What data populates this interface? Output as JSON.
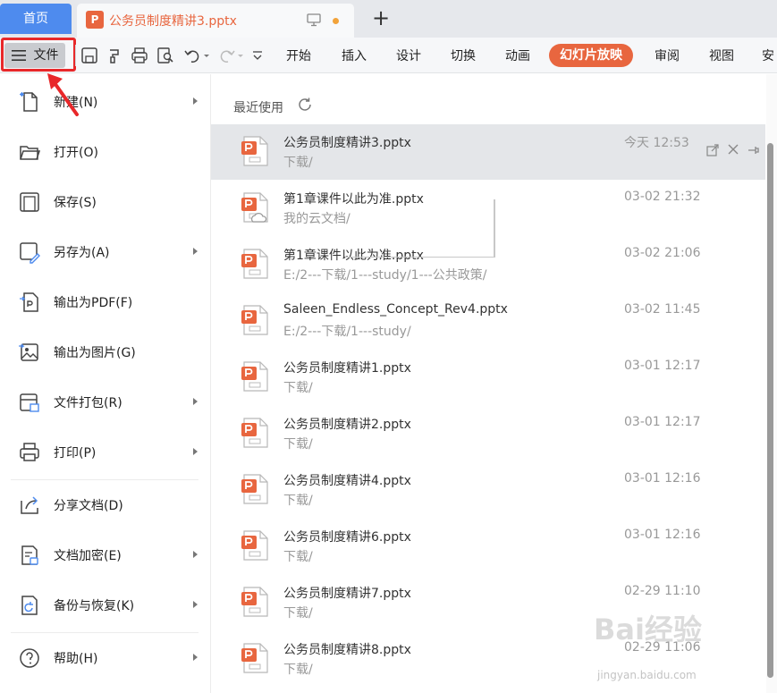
{
  "tabs": {
    "home": "首页",
    "document": "公务员制度精讲3.pptx",
    "add": "+"
  },
  "toolbar": {
    "file_label": "文件",
    "ribbon_tabs": [
      "开始",
      "插入",
      "设计",
      "切换",
      "动画",
      "幻灯片放映",
      "审阅",
      "视图",
      "安"
    ],
    "active_tab": "幻灯片放映",
    "accent_color": "#e8663f",
    "icons": [
      "save-icon",
      "format-painter-icon",
      "print-icon",
      "print-preview-icon",
      "undo-icon",
      "redo-icon",
      "more-icon"
    ]
  },
  "file_menu": {
    "items": [
      {
        "label": "新建(N)",
        "icon": "new-file-icon",
        "submenu": true
      },
      {
        "label": "打开(O)",
        "icon": "folder-open-icon",
        "submenu": false
      },
      {
        "label": "保存(S)",
        "icon": "save-icon",
        "submenu": false
      },
      {
        "label": "另存为(A)",
        "icon": "save-as-icon",
        "submenu": true
      },
      {
        "label": "输出为PDF(F)",
        "icon": "export-pdf-icon",
        "submenu": false
      },
      {
        "label": "输出为图片(G)",
        "icon": "export-image-icon",
        "submenu": false
      },
      {
        "label": "文件打包(R)",
        "icon": "package-icon",
        "submenu": true
      },
      {
        "label": "打印(P)",
        "icon": "print-icon",
        "submenu": true
      },
      {
        "label": "分享文档(D)",
        "icon": "share-icon",
        "submenu": false
      },
      {
        "label": "文档加密(E)",
        "icon": "encrypt-icon",
        "submenu": true
      },
      {
        "label": "备份与恢复(K)",
        "icon": "backup-icon",
        "submenu": true
      },
      {
        "label": "帮助(H)",
        "icon": "help-icon",
        "submenu": true
      }
    ]
  },
  "recent": {
    "header": "最近使用",
    "files": [
      {
        "name": "公务员制度精讲3.pptx",
        "path": "下载/",
        "time": "今天 12:53",
        "selected": true
      },
      {
        "name": "第1章课件以此为准.pptx",
        "path": "我的云文档/",
        "time": "03-02 21:32",
        "cloud": true
      },
      {
        "name": "第1章课件以此为准.pptx",
        "path": "E:/2---下载/1---study/1---公共政策/",
        "time": "03-02 21:06"
      },
      {
        "name": "Saleen_Endless_Concept_Rev4.pptx",
        "path": "E:/2---下载/1---study/",
        "time": "03-02 11:45"
      },
      {
        "name": "公务员制度精讲1.pptx",
        "path": "下载/",
        "time": "03-01 12:17"
      },
      {
        "name": "公务员制度精讲2.pptx",
        "path": "下载/",
        "time": "03-01 12:17"
      },
      {
        "name": "公务员制度精讲4.pptx",
        "path": "下载/",
        "time": "03-01 12:16"
      },
      {
        "name": "公务员制度精讲6.pptx",
        "path": "下载/",
        "time": "03-01 12:16"
      },
      {
        "name": "公务员制度精讲7.pptx",
        "path": "下载/",
        "time": "02-29 11:10"
      },
      {
        "name": "公务员制度精讲8.pptx",
        "path": "下载/",
        "time": "02-29 11:06"
      }
    ]
  },
  "watermark": {
    "brand": "Bai经验",
    "url": "jingyan.baidu.com"
  }
}
